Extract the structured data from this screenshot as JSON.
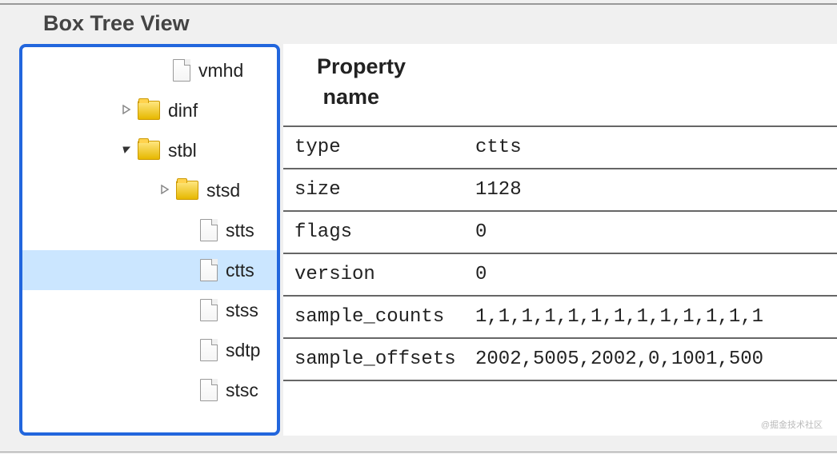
{
  "title": "Box Tree View",
  "tree": {
    "items": [
      {
        "label": "vmhd",
        "icon": "file",
        "indent": "indent-1",
        "expander": "none",
        "selected": false
      },
      {
        "label": "dinf",
        "icon": "folder",
        "indent": "indent-2e",
        "expander": "collapsed",
        "selected": false
      },
      {
        "label": "stbl",
        "icon": "folder",
        "indent": "indent-2e",
        "expander": "expanded",
        "selected": false
      },
      {
        "label": "stsd",
        "icon": "folder",
        "indent": "indent-3",
        "expander": "collapsed",
        "selected": false
      },
      {
        "label": "stts",
        "icon": "file",
        "indent": "indent-3f",
        "expander": "none",
        "selected": false
      },
      {
        "label": "ctts",
        "icon": "file",
        "indent": "indent-3f",
        "expander": "none",
        "selected": true
      },
      {
        "label": "stss",
        "icon": "file",
        "indent": "indent-3f",
        "expander": "none",
        "selected": false
      },
      {
        "label": "sdtp",
        "icon": "file",
        "indent": "indent-3f",
        "expander": "none",
        "selected": false
      },
      {
        "label": "stsc",
        "icon": "file",
        "indent": "indent-3f",
        "expander": "none",
        "selected": false
      }
    ]
  },
  "props": {
    "header_line1": "Property",
    "header_line2": "name",
    "rows": [
      {
        "name": "type",
        "value": "ctts"
      },
      {
        "name": "size",
        "value": "1128"
      },
      {
        "name": "flags",
        "value": "0"
      },
      {
        "name": "version",
        "value": "0"
      },
      {
        "name": "sample_counts",
        "value": "1,1,1,1,1,1,1,1,1,1,1,1,1"
      },
      {
        "name": "sample_offsets",
        "value": "2002,5005,2002,0,1001,500"
      }
    ]
  },
  "watermark": "@掘金技术社区"
}
